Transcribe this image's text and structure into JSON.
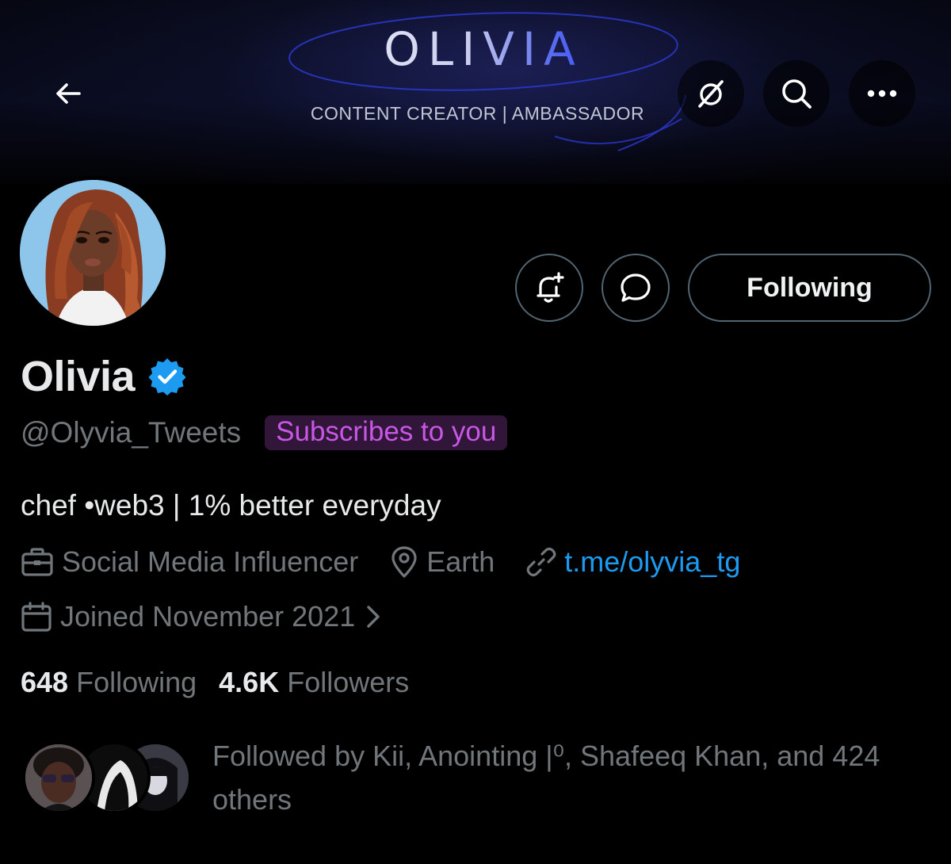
{
  "banner": {
    "title": "OLIVIA",
    "subtitle": "CONTENT CREATOR  |  AMBASSADOR"
  },
  "topbar": {
    "back_icon": "arrow-left-icon",
    "grok_icon": "grok-icon",
    "search_icon": "search-icon",
    "more_icon": "more-horizontal-icon"
  },
  "actions": {
    "notify_icon": "bell-plus-icon",
    "message_icon": "message-bubble-icon",
    "following_label": "Following"
  },
  "profile": {
    "display_name": "Olivia",
    "verified_icon": "verified-badge-icon",
    "handle": "@Olyvia_Tweets",
    "subscribes_badge": "Subscribes to you",
    "bio": "chef •web3 | 1% better everyday",
    "category": "Social Media Influencer",
    "location": "Earth",
    "link": "t.me/olyvia_tg",
    "joined": "Joined November 2021"
  },
  "stats": {
    "following_count": "648",
    "following_label": "Following",
    "followers_count": "4.6K",
    "followers_label": "Followers"
  },
  "followed_by": {
    "text": "Followed by Kii, Anointing |⁰, Shafeeq Khan, and 424 others"
  },
  "colors": {
    "background": "#000000",
    "text_primary": "#e7e9ea",
    "text_secondary": "#71767b",
    "link": "#1d9bf0",
    "verified": "#1d9bf0",
    "subscribes_text": "#c957e6",
    "subscribes_bg": "#32163a",
    "border": "#536471"
  }
}
